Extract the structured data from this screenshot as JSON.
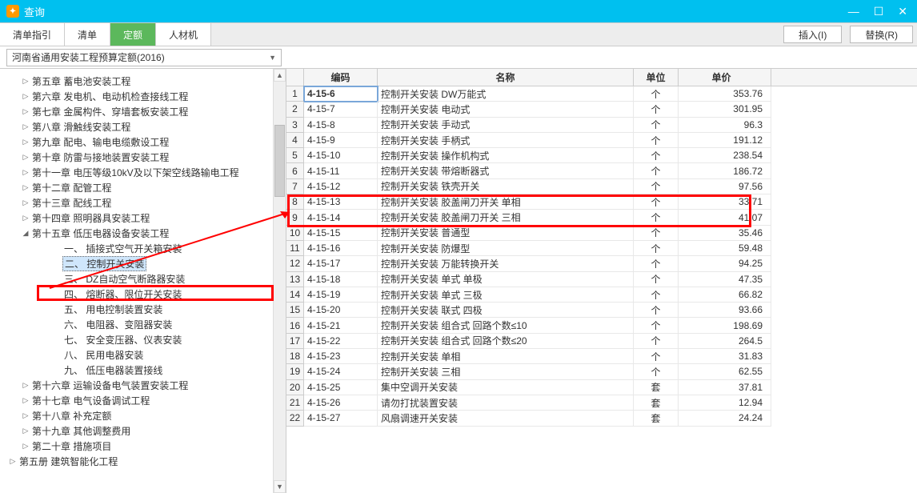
{
  "titlebar": {
    "title": "查询"
  },
  "tabs": {
    "items": [
      "清单指引",
      "清单",
      "定额",
      "人材机"
    ],
    "active_index": 2
  },
  "toolbar": {
    "insert": "插入(I)",
    "replace": "替换(R)"
  },
  "breadcrumb": {
    "label": "河南省通用安装工程预算定额(2016)"
  },
  "sidebar": {
    "items": [
      {
        "level": 1,
        "exp": "▷",
        "label": "第五章 蓄电池安装工程"
      },
      {
        "level": 1,
        "exp": "▷",
        "label": "第六章 发电机、电动机检查接线工程"
      },
      {
        "level": 1,
        "exp": "▷",
        "label": "第七章 金属构件、穿墙套板安装工程"
      },
      {
        "level": 1,
        "exp": "▷",
        "label": "第八章 滑触线安装工程"
      },
      {
        "level": 1,
        "exp": "▷",
        "label": "第九章 配电、输电电缆敷设工程"
      },
      {
        "level": 1,
        "exp": "▷",
        "label": "第十章 防雷与接地装置安装工程"
      },
      {
        "level": 1,
        "exp": "▷",
        "label": "第十一章 电压等级10kV及以下架空线路输电工程"
      },
      {
        "level": 1,
        "exp": "▷",
        "label": "第十二章 配管工程"
      },
      {
        "level": 1,
        "exp": "▷",
        "label": "第十三章 配线工程"
      },
      {
        "level": 1,
        "exp": "▷",
        "label": "第十四章 照明器具安装工程"
      },
      {
        "level": 1,
        "exp": "◢",
        "label": "第十五章 低压电器设备安装工程"
      },
      {
        "level": 2,
        "exp": "",
        "label": "一、 插接式空气开关箱安装"
      },
      {
        "level": 2,
        "exp": "",
        "label": "二、 控制开关安装",
        "selected": true
      },
      {
        "level": 2,
        "exp": "",
        "label": "三、 DZ自动空气断路器安装"
      },
      {
        "level": 2,
        "exp": "",
        "label": "四、 熔断器、限位开关安装"
      },
      {
        "level": 2,
        "exp": "",
        "label": "五、 用电控制装置安装"
      },
      {
        "level": 2,
        "exp": "",
        "label": "六、 电阻器、变阻器安装"
      },
      {
        "level": 2,
        "exp": "",
        "label": "七、 安全变压器、仪表安装"
      },
      {
        "level": 2,
        "exp": "",
        "label": "八、 民用电器安装"
      },
      {
        "level": 2,
        "exp": "",
        "label": "九、 低压电器装置接线"
      },
      {
        "level": 1,
        "exp": "▷",
        "label": "第十六章 运输设备电气装置安装工程"
      },
      {
        "level": 1,
        "exp": "▷",
        "label": "第十七章 电气设备调试工程"
      },
      {
        "level": 1,
        "exp": "▷",
        "label": "第十八章 补充定额"
      },
      {
        "level": 1,
        "exp": "▷",
        "label": "第十九章 其他调整费用"
      },
      {
        "level": 1,
        "exp": "▷",
        "label": "第二十章 措施项目"
      },
      {
        "level": 0,
        "exp": "▷",
        "label": "第五册 建筑智能化工程"
      }
    ]
  },
  "grid": {
    "columns": {
      "code": "编码",
      "name": "名称",
      "unit": "单位",
      "price": "单价"
    },
    "rows": [
      {
        "idx": 1,
        "code": "4-15-6",
        "name": "控制开关安装  DW万能式",
        "unit": "个",
        "price": "353.76",
        "selcell": true
      },
      {
        "idx": 2,
        "code": "4-15-7",
        "name": "控制开关安装  电动式",
        "unit": "个",
        "price": "301.95"
      },
      {
        "idx": 3,
        "code": "4-15-8",
        "name": "控制开关安装  手动式",
        "unit": "个",
        "price": "96.3"
      },
      {
        "idx": 4,
        "code": "4-15-9",
        "name": "控制开关安装  手柄式",
        "unit": "个",
        "price": "191.12"
      },
      {
        "idx": 5,
        "code": "4-15-10",
        "name": "控制开关安装  操作机构式",
        "unit": "个",
        "price": "238.54"
      },
      {
        "idx": 6,
        "code": "4-15-11",
        "name": "控制开关安装  带熔断器式",
        "unit": "个",
        "price": "186.72"
      },
      {
        "idx": 7,
        "code": "4-15-12",
        "name": "控制开关安装  铁壳开关",
        "unit": "个",
        "price": "97.56"
      },
      {
        "idx": 8,
        "code": "4-15-13",
        "name": "控制开关安装  胶盖闸刀开关  单相",
        "unit": "个",
        "price": "33.71"
      },
      {
        "idx": 9,
        "code": "4-15-14",
        "name": "控制开关安装  胶盖闸刀开关  三相",
        "unit": "个",
        "price": "41.07"
      },
      {
        "idx": 10,
        "code": "4-15-15",
        "name": "控制开关安装  普通型",
        "unit": "个",
        "price": "35.46"
      },
      {
        "idx": 11,
        "code": "4-15-16",
        "name": "控制开关安装  防爆型",
        "unit": "个",
        "price": "59.48"
      },
      {
        "idx": 12,
        "code": "4-15-17",
        "name": "控制开关安装  万能转换开关",
        "unit": "个",
        "price": "94.25"
      },
      {
        "idx": 13,
        "code": "4-15-18",
        "name": "控制开关安装  单式  单极",
        "unit": "个",
        "price": "47.35"
      },
      {
        "idx": 14,
        "code": "4-15-19",
        "name": "控制开关安装  单式  三极",
        "unit": "个",
        "price": "66.82"
      },
      {
        "idx": 15,
        "code": "4-15-20",
        "name": "控制开关安装  联式  四极",
        "unit": "个",
        "price": "93.66"
      },
      {
        "idx": 16,
        "code": "4-15-21",
        "name": "控制开关安装  组合式  回路个数≤10",
        "unit": "个",
        "price": "198.69"
      },
      {
        "idx": 17,
        "code": "4-15-22",
        "name": "控制开关安装  组合式  回路个数≤20",
        "unit": "个",
        "price": "264.5"
      },
      {
        "idx": 18,
        "code": "4-15-23",
        "name": "控制开关安装  单相",
        "unit": "个",
        "price": "31.83"
      },
      {
        "idx": 19,
        "code": "4-15-24",
        "name": "控制开关安装  三相",
        "unit": "个",
        "price": "62.55"
      },
      {
        "idx": 20,
        "code": "4-15-25",
        "name": "集中空调开关安装",
        "unit": "套",
        "price": "37.81"
      },
      {
        "idx": 21,
        "code": "4-15-26",
        "name": "请勿打扰装置安装",
        "unit": "套",
        "price": "12.94"
      },
      {
        "idx": 22,
        "code": "4-15-27",
        "name": "风扇调速开关安装",
        "unit": "套",
        "price": "24.24"
      }
    ]
  }
}
